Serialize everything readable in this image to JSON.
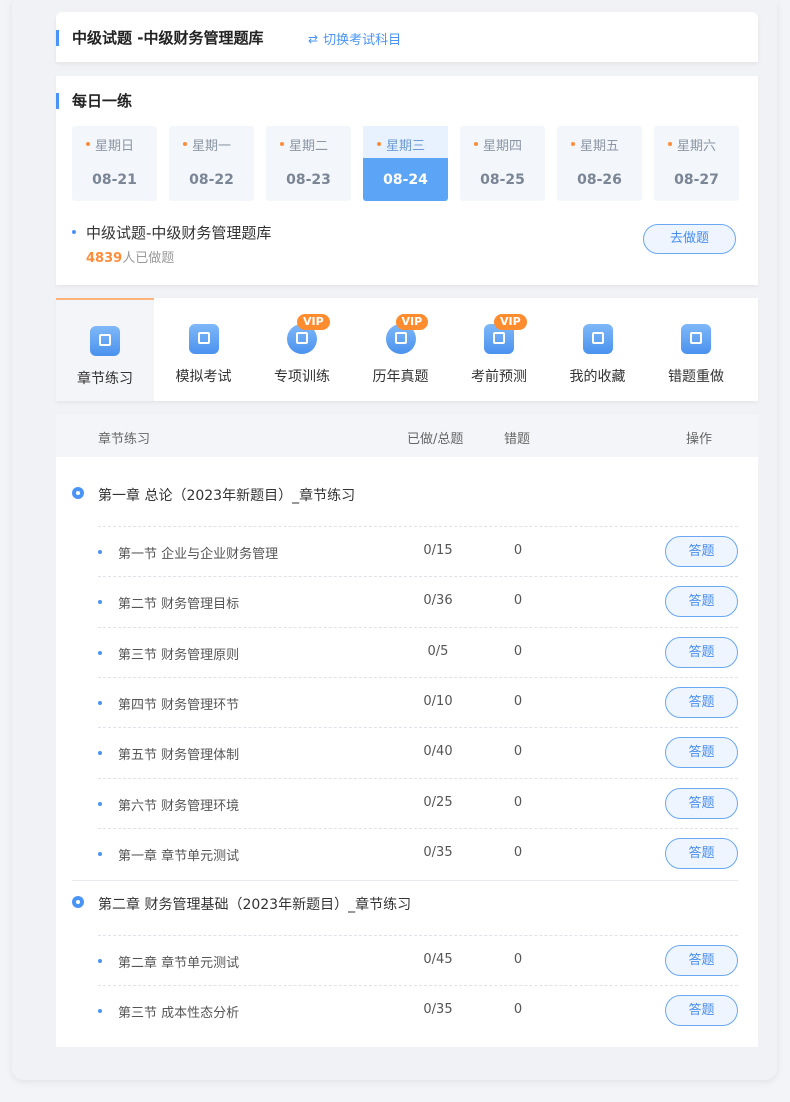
{
  "header": {
    "title": "中级试题 -中级财务管理题库",
    "switch_label": "切换考试科目",
    "switch_icon": "swap-icon"
  },
  "daily": {
    "title": "每日一练",
    "days": [
      {
        "week": "星期日",
        "date": "08-21"
      },
      {
        "week": "星期一",
        "date": "08-22"
      },
      {
        "week": "星期二",
        "date": "08-23"
      },
      {
        "week": "星期三",
        "date": "08-24"
      },
      {
        "week": "星期四",
        "date": "08-25"
      },
      {
        "week": "星期五",
        "date": "08-26"
      },
      {
        "week": "星期六",
        "date": "08-27"
      }
    ],
    "selected_date": "08-24",
    "item_name": "中级试题-中级财务管理题库",
    "count": "4839",
    "count_suffix": "人已做题",
    "go_label": "去做题"
  },
  "tabs": [
    {
      "label": "章节练习",
      "icon": "book-icon",
      "vip": ""
    },
    {
      "label": "模拟考试",
      "icon": "scroll-icon",
      "vip": ""
    },
    {
      "label": "专项训练",
      "icon": "target-icon",
      "vip": "VIP"
    },
    {
      "label": "历年真题",
      "icon": "medal-icon",
      "vip": "VIP"
    },
    {
      "label": "考前预测",
      "icon": "graduation-cap-icon",
      "vip": "VIP"
    },
    {
      "label": "我的收藏",
      "icon": "star-bookmark-icon",
      "vip": ""
    },
    {
      "label": "错题重做",
      "icon": "error-redo-icon",
      "vip": ""
    }
  ],
  "table": {
    "headers": {
      "name": "章节练习",
      "done": "已做/总题",
      "wrong": "错题",
      "action": "操作"
    },
    "answer_label": "答题",
    "chapters": [
      {
        "title": "第一章 总论（2023年新题目）_章节练习",
        "rows": [
          {
            "name": "第一节 企业与企业财务管理",
            "done": "0/15",
            "wrong": "0"
          },
          {
            "name": "第二节 财务管理目标",
            "done": "0/36",
            "wrong": "0"
          },
          {
            "name": "第三节 财务管理原则",
            "done": "0/5",
            "wrong": "0"
          },
          {
            "name": "第四节 财务管理环节",
            "done": "0/10",
            "wrong": "0"
          },
          {
            "name": "第五节 财务管理体制",
            "done": "0/40",
            "wrong": "0"
          },
          {
            "name": "第六节 财务管理环境",
            "done": "0/25",
            "wrong": "0"
          },
          {
            "name": "第一章 章节单元测试",
            "done": "0/35",
            "wrong": "0"
          }
        ]
      },
      {
        "title": "第二章 财务管理基础（2023年新题目）_章节练习",
        "rows": [
          {
            "name": "第二章 章节单元测试",
            "done": "0/45",
            "wrong": "0"
          },
          {
            "name": "第三节 成本性态分析",
            "done": "0/35",
            "wrong": "0"
          }
        ]
      }
    ]
  },
  "colors": {
    "accent": "#4a94f7",
    "orange": "#ff8c3a",
    "vip": "#ff8c2f"
  }
}
